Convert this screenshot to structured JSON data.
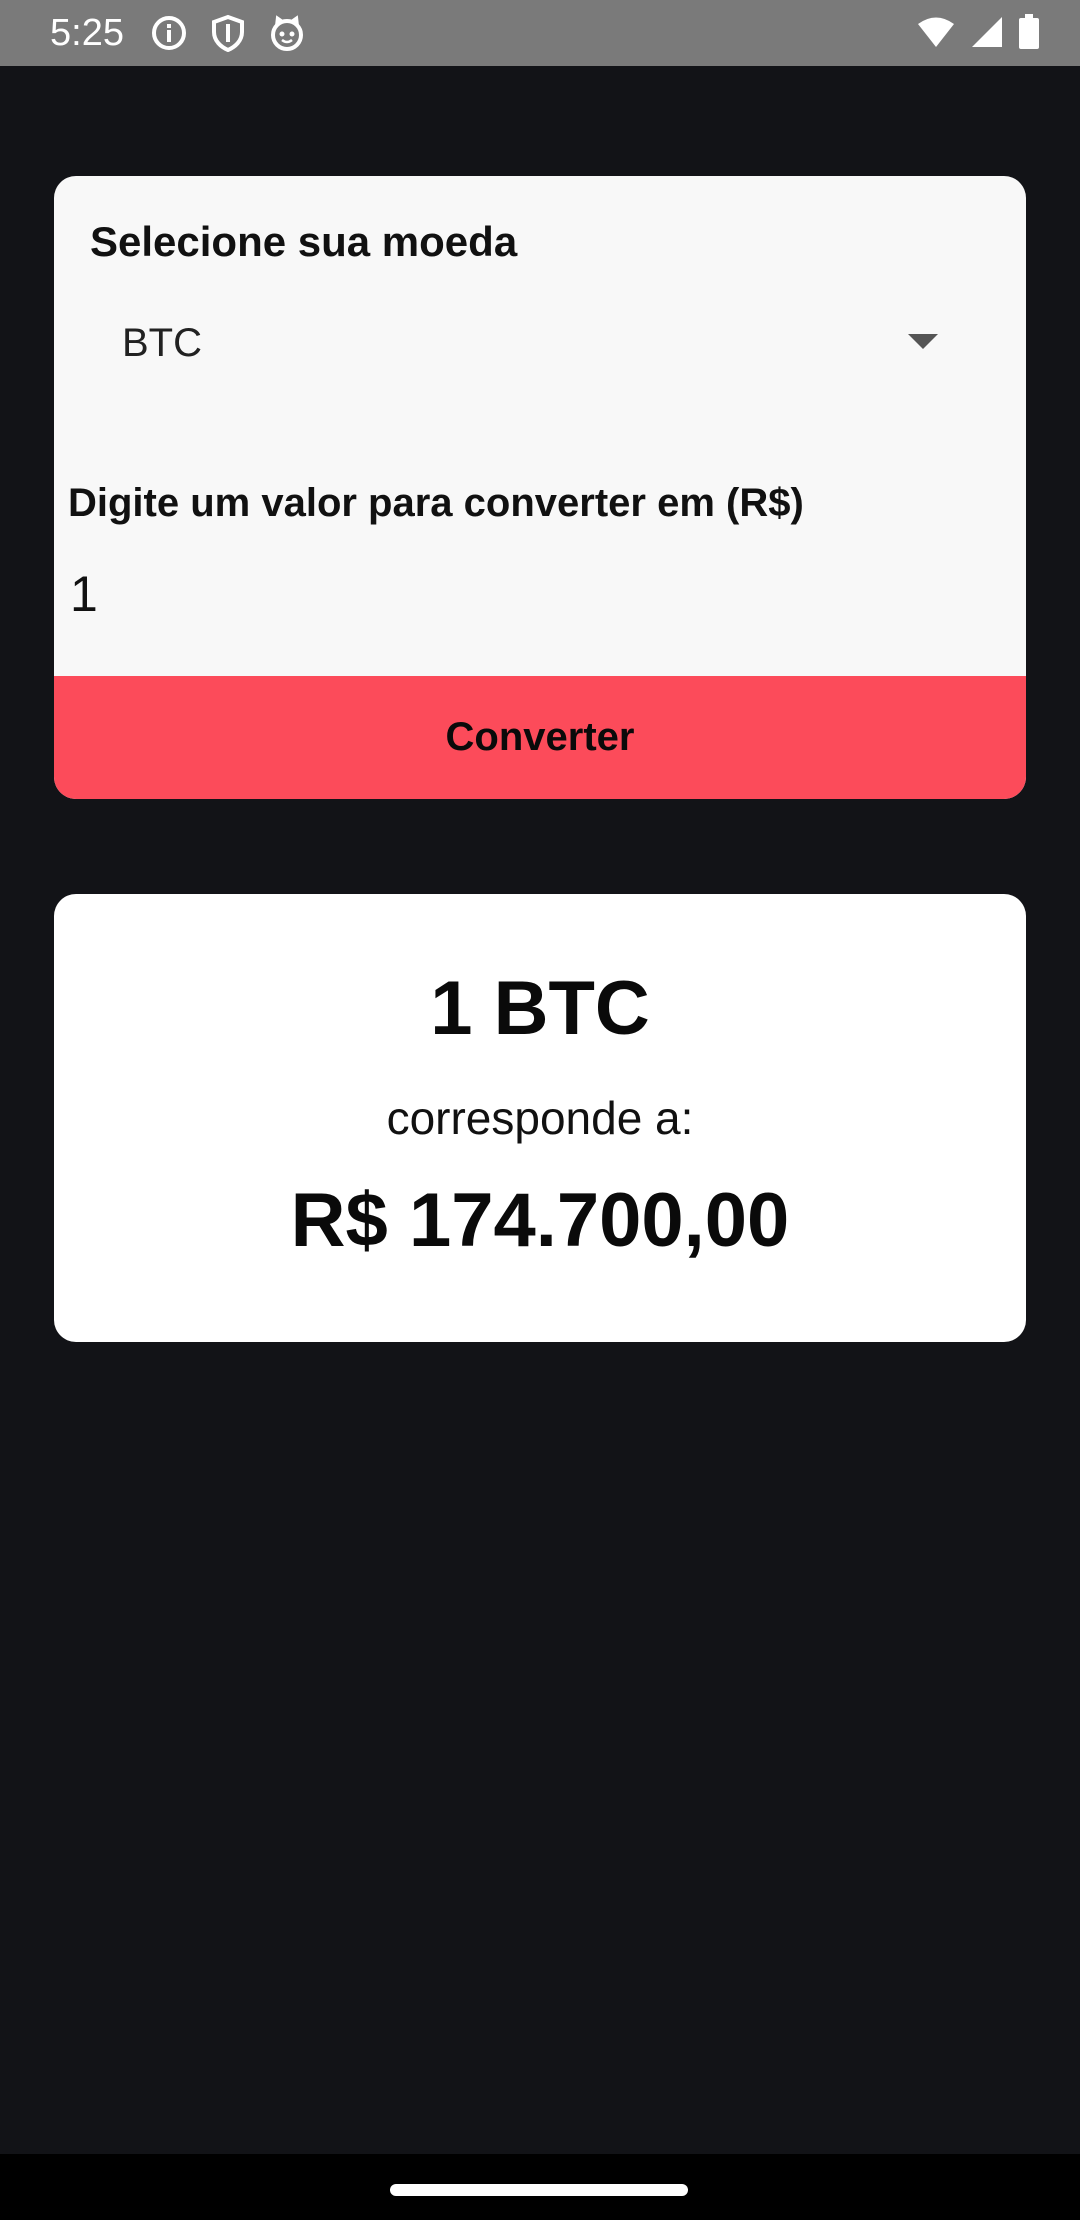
{
  "status_bar": {
    "time": "5:25",
    "left_icons": [
      "info-icon",
      "shield-icon",
      "cat-face-icon"
    ],
    "right_icons": [
      "wifi-icon",
      "cellular-signal-icon",
      "battery-icon"
    ]
  },
  "converter": {
    "select_label": "Selecione sua moeda",
    "selected_currency": "BTC",
    "amount_label": "Digite um valor para converter em (R$)",
    "amount_value": "1",
    "convert_button_label": "Converter"
  },
  "result": {
    "amount": "1 BTC",
    "connector": "corresponde a:",
    "value": "R$ 174.700,00"
  },
  "colors": {
    "background": "#121317",
    "card": "#f8f8f8",
    "result_card": "#ffffff",
    "accent": "#fc4b5a",
    "status_bar": "#7a7a7a"
  }
}
